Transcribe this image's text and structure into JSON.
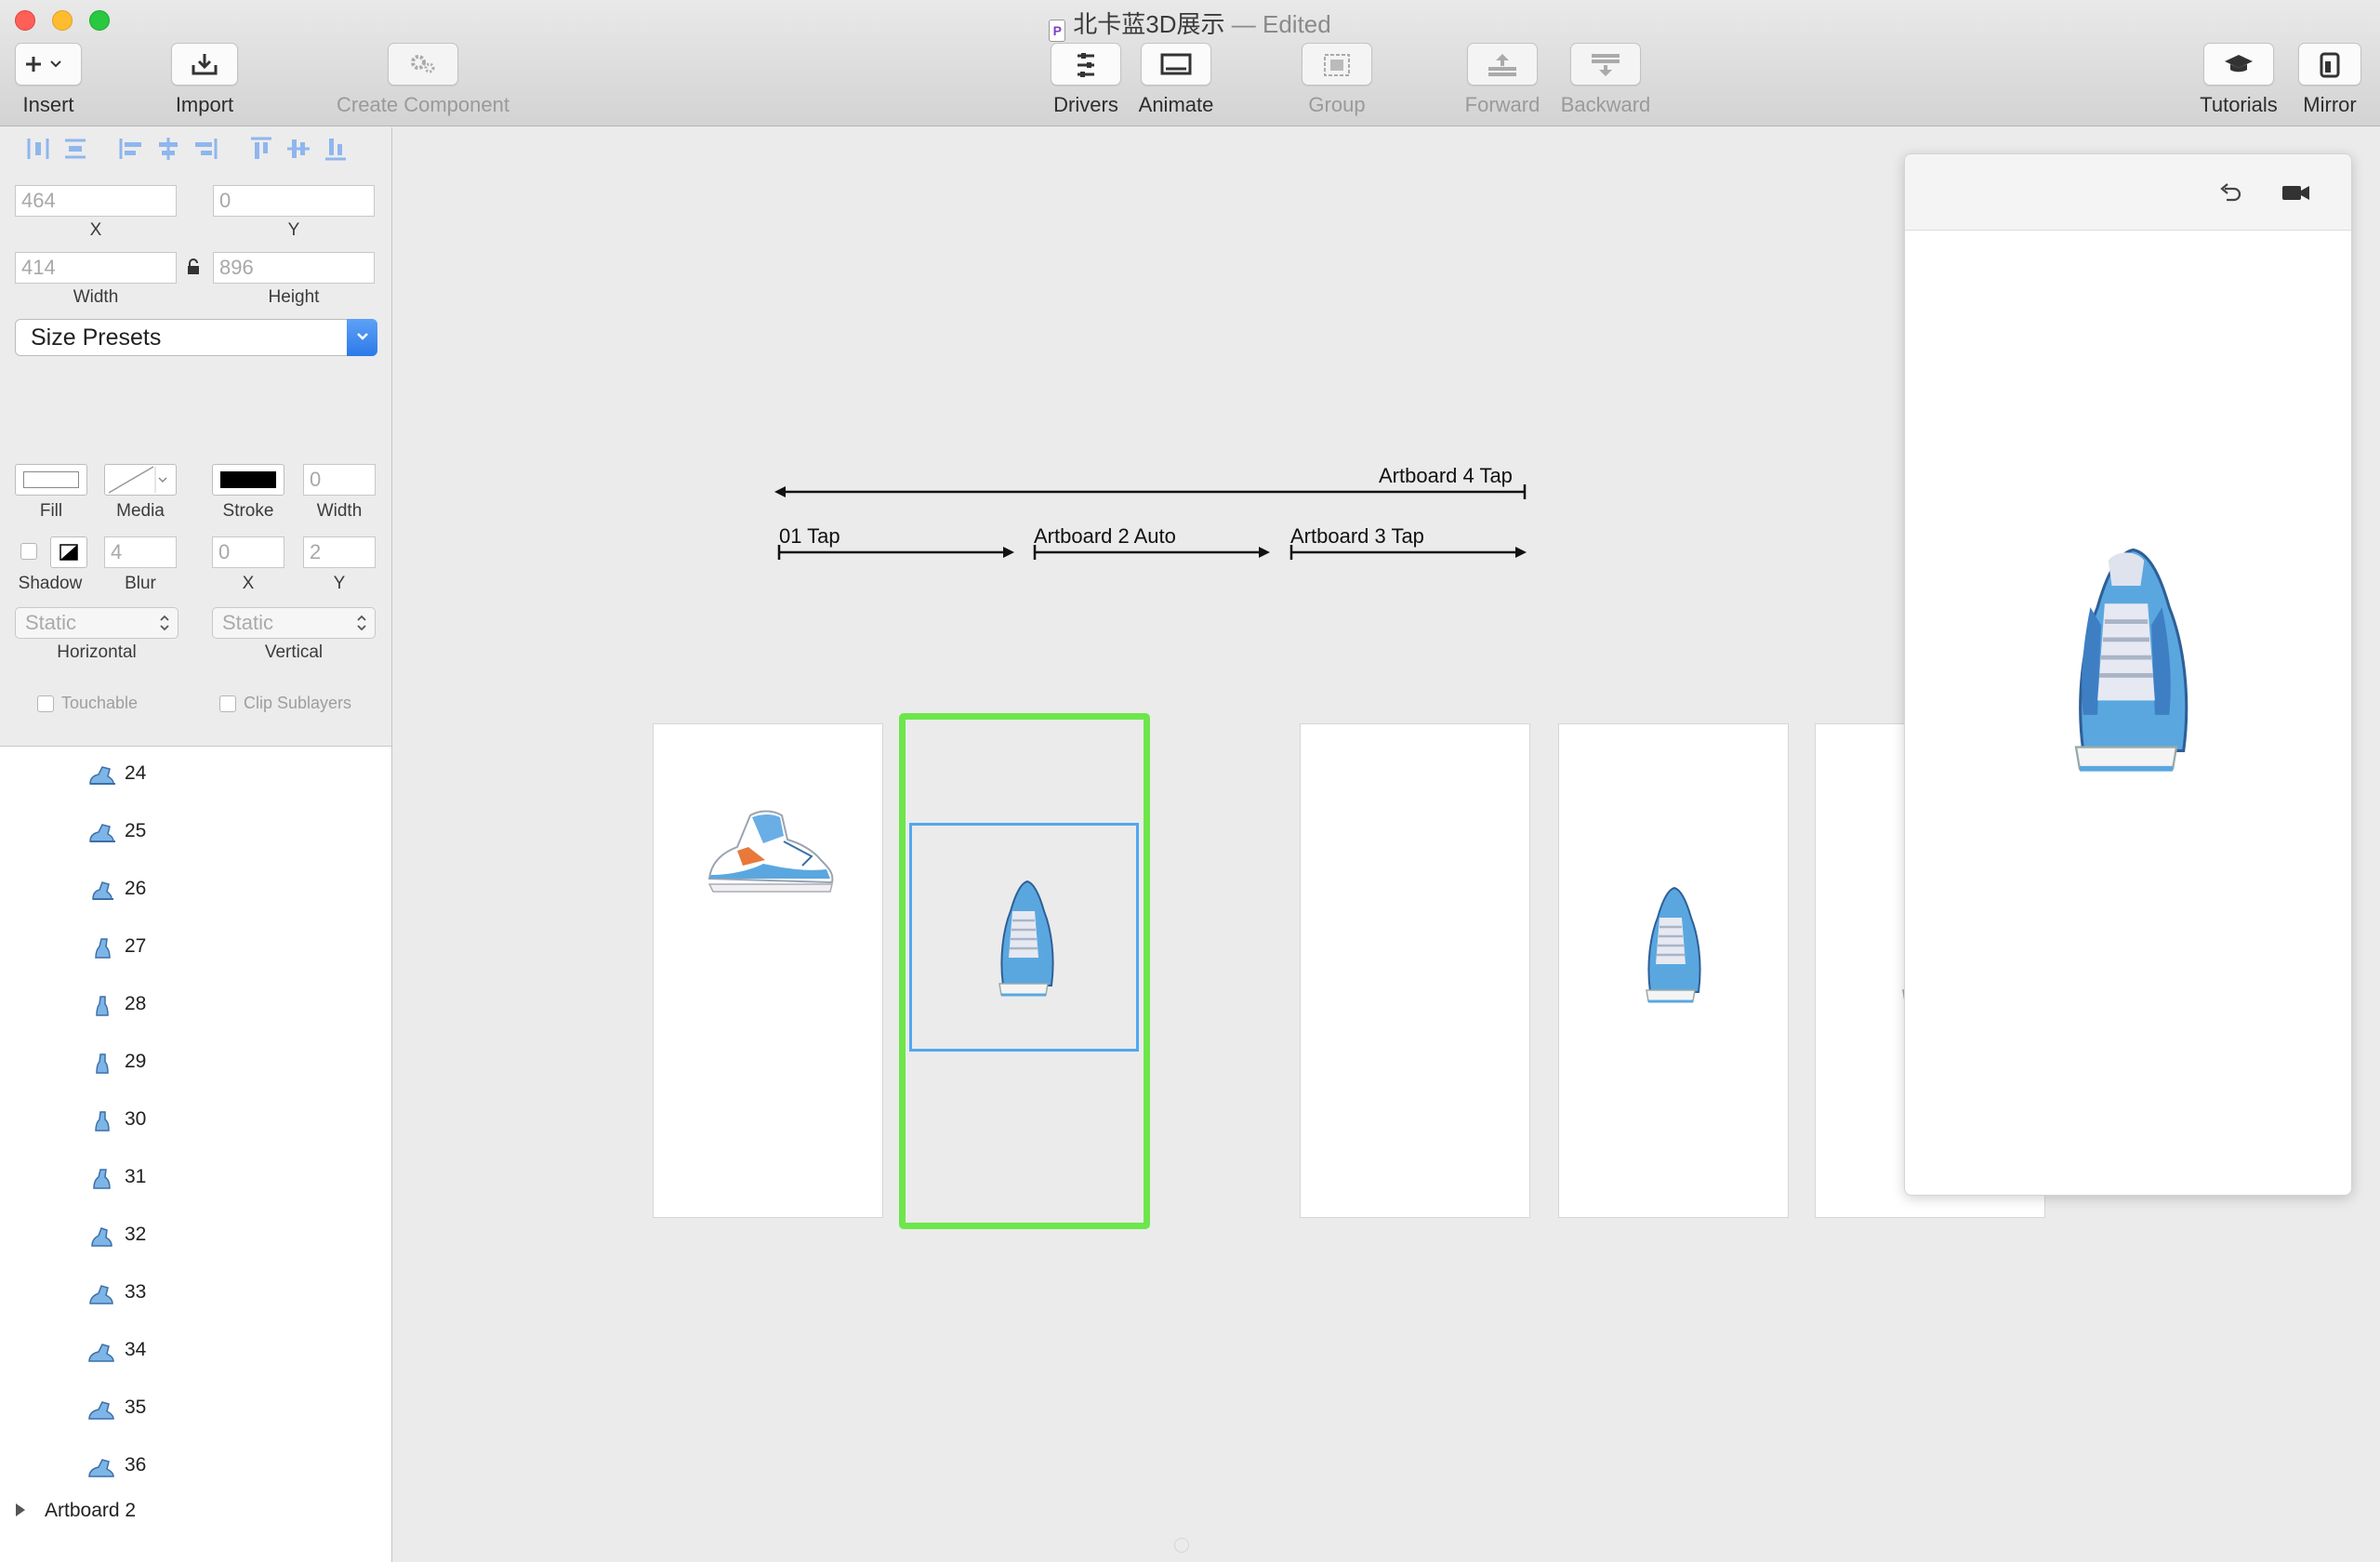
{
  "window": {
    "title": "北卡蓝3D展示",
    "edited": "— Edited"
  },
  "toolbar": {
    "insert": "Insert",
    "import": "Import",
    "create_component": "Create Component",
    "drivers": "Drivers",
    "animate": "Animate",
    "group": "Group",
    "forward": "Forward",
    "backward": "Backward",
    "tutorials": "Tutorials",
    "mirror": "Mirror"
  },
  "inspector": {
    "x": {
      "value": "464",
      "label": "X"
    },
    "y": {
      "value": "0",
      "label": "Y"
    },
    "width": {
      "value": "414",
      "label": "Width"
    },
    "height": {
      "value": "896",
      "label": "Height"
    },
    "size_presets": "Size Presets",
    "fill_label": "Fill",
    "media_label": "Media",
    "stroke_label": "Stroke",
    "stroke_width": {
      "value": "0",
      "label": "Width"
    },
    "shadow_label": "Shadow",
    "blur": {
      "value": "4",
      "label": "Blur"
    },
    "shadow_x": {
      "value": "0",
      "label": "X"
    },
    "shadow_y": {
      "value": "2",
      "label": "Y"
    },
    "horizontal": {
      "value": "Static",
      "label": "Horizontal"
    },
    "vertical": {
      "value": "Static",
      "label": "Vertical"
    },
    "touchable": "Touchable",
    "clip_sublayers": "Clip Sublayers"
  },
  "layers": {
    "items": [
      "24",
      "25",
      "26",
      "27",
      "28",
      "29",
      "30",
      "31",
      "32",
      "33",
      "34",
      "35",
      "36"
    ],
    "group": "Artboard 2"
  },
  "canvas": {
    "connections": {
      "back": "Artboard 4 Tap",
      "c1": "01 Tap",
      "c2": "Artboard 2 Auto",
      "c3": "Artboard 3 Tap"
    }
  },
  "colors": {
    "selection_green": "#6de64b",
    "selection_blue": "#4fa8f0",
    "shoe_blue": "#5aa7e0"
  }
}
